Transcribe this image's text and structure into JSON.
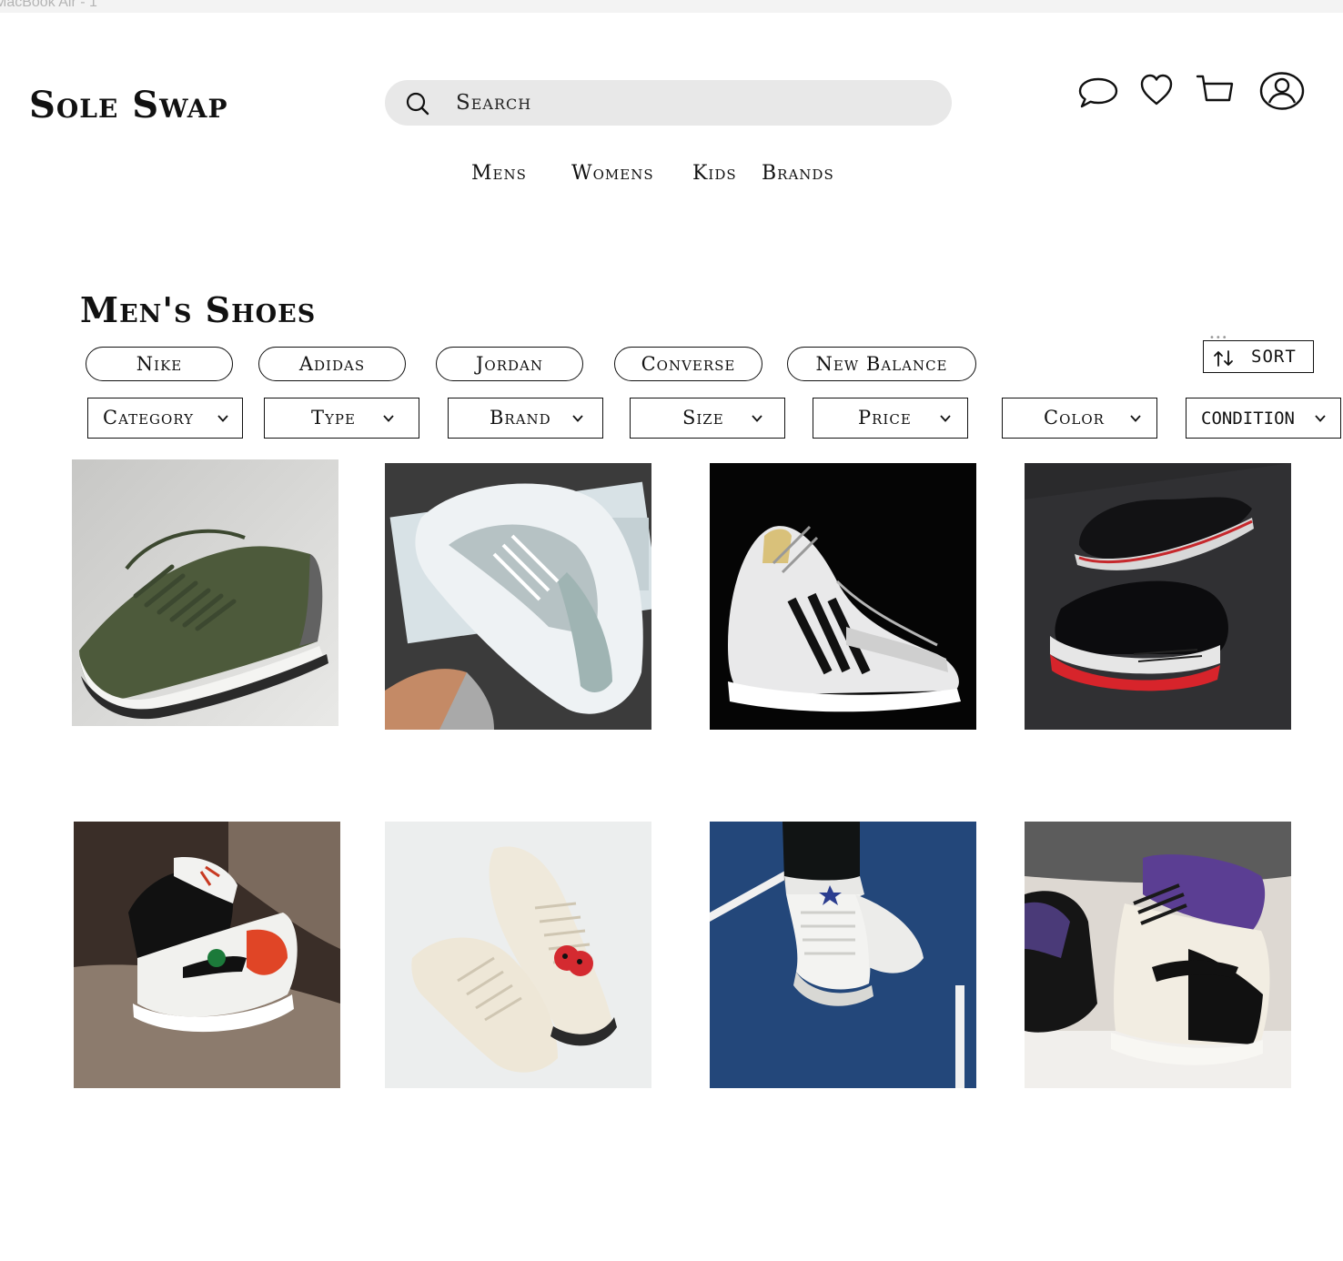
{
  "window": {
    "label": "MacBook Air - 1"
  },
  "brand": {
    "name": "Sole Swap"
  },
  "search": {
    "placeholder": "Search"
  },
  "header_icons": [
    "chat-bubble-icon",
    "heart-icon",
    "cart-icon",
    "user-avatar-icon"
  ],
  "nav": {
    "items": [
      "Mens",
      "Womens",
      "Kids",
      "Brands"
    ]
  },
  "page": {
    "title": "Men's Shoes"
  },
  "brand_chips": [
    "Nike",
    "Adidas",
    "Jordan",
    "Converse",
    "New Balance"
  ],
  "sort": {
    "label": "SORT",
    "icon": "sort-arrows-icon"
  },
  "filters": [
    "Category",
    "Type",
    "Brand",
    "Size",
    "Price",
    "Color",
    "CONDITION"
  ],
  "products": [
    {
      "image": "olive green low-top sneaker"
    },
    {
      "image": "white and grey Nike running sneaker held in hand"
    },
    {
      "image": "white Adidas Superstar with black stripes"
    },
    {
      "image": "black patent Jordan 11 with red sole"
    },
    {
      "image": "Jordan 1 Mid white black red"
    },
    {
      "image": "cream Converse high-top with red heart logo"
    },
    {
      "image": "white Converse high-tops on blue court"
    },
    {
      "image": "Jordan 1 high court purple"
    }
  ]
}
